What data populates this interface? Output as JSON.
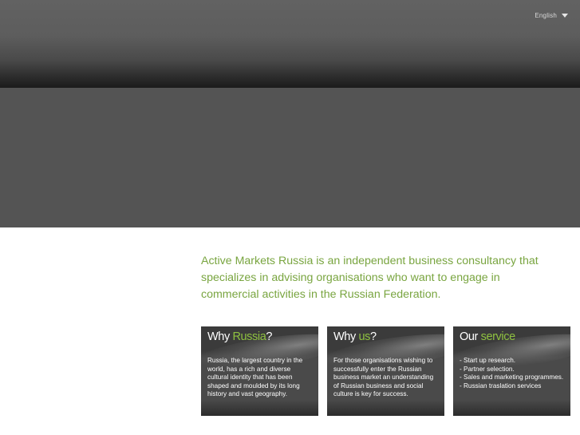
{
  "header": {
    "language": "English"
  },
  "intro": {
    "text": "Active Markets Russia is an independent business consultancy that specializes in advising organisations who want to engage in commercial activities in the Russian Federation."
  },
  "cards": [
    {
      "title_prefix": "Why ",
      "title_accent": "Russia",
      "title_suffix": "?",
      "body": "Russia, the largest country in the world, has a rich and diverse cultural identity that has been shaped and moulded by its long history and vast geography."
    },
    {
      "title_prefix": "Why ",
      "title_accent": "us",
      "title_suffix": "?",
      "body": "For those organisations wishing to successfully enter the Russian business market an understanding of Russian business and social culture is key for success."
    },
    {
      "title_prefix": "Our ",
      "title_accent": "service",
      "title_suffix": "",
      "items": [
        "- Start up research.",
        "- Partner selection.",
        "- Sales and marketing programmes.",
        "- Russian traslation services"
      ]
    }
  ],
  "colors": {
    "accent_green": "#79a540",
    "card_accent": "#8ec040",
    "header_dark": "#1b1b1b",
    "banner_gray": "#545454"
  }
}
